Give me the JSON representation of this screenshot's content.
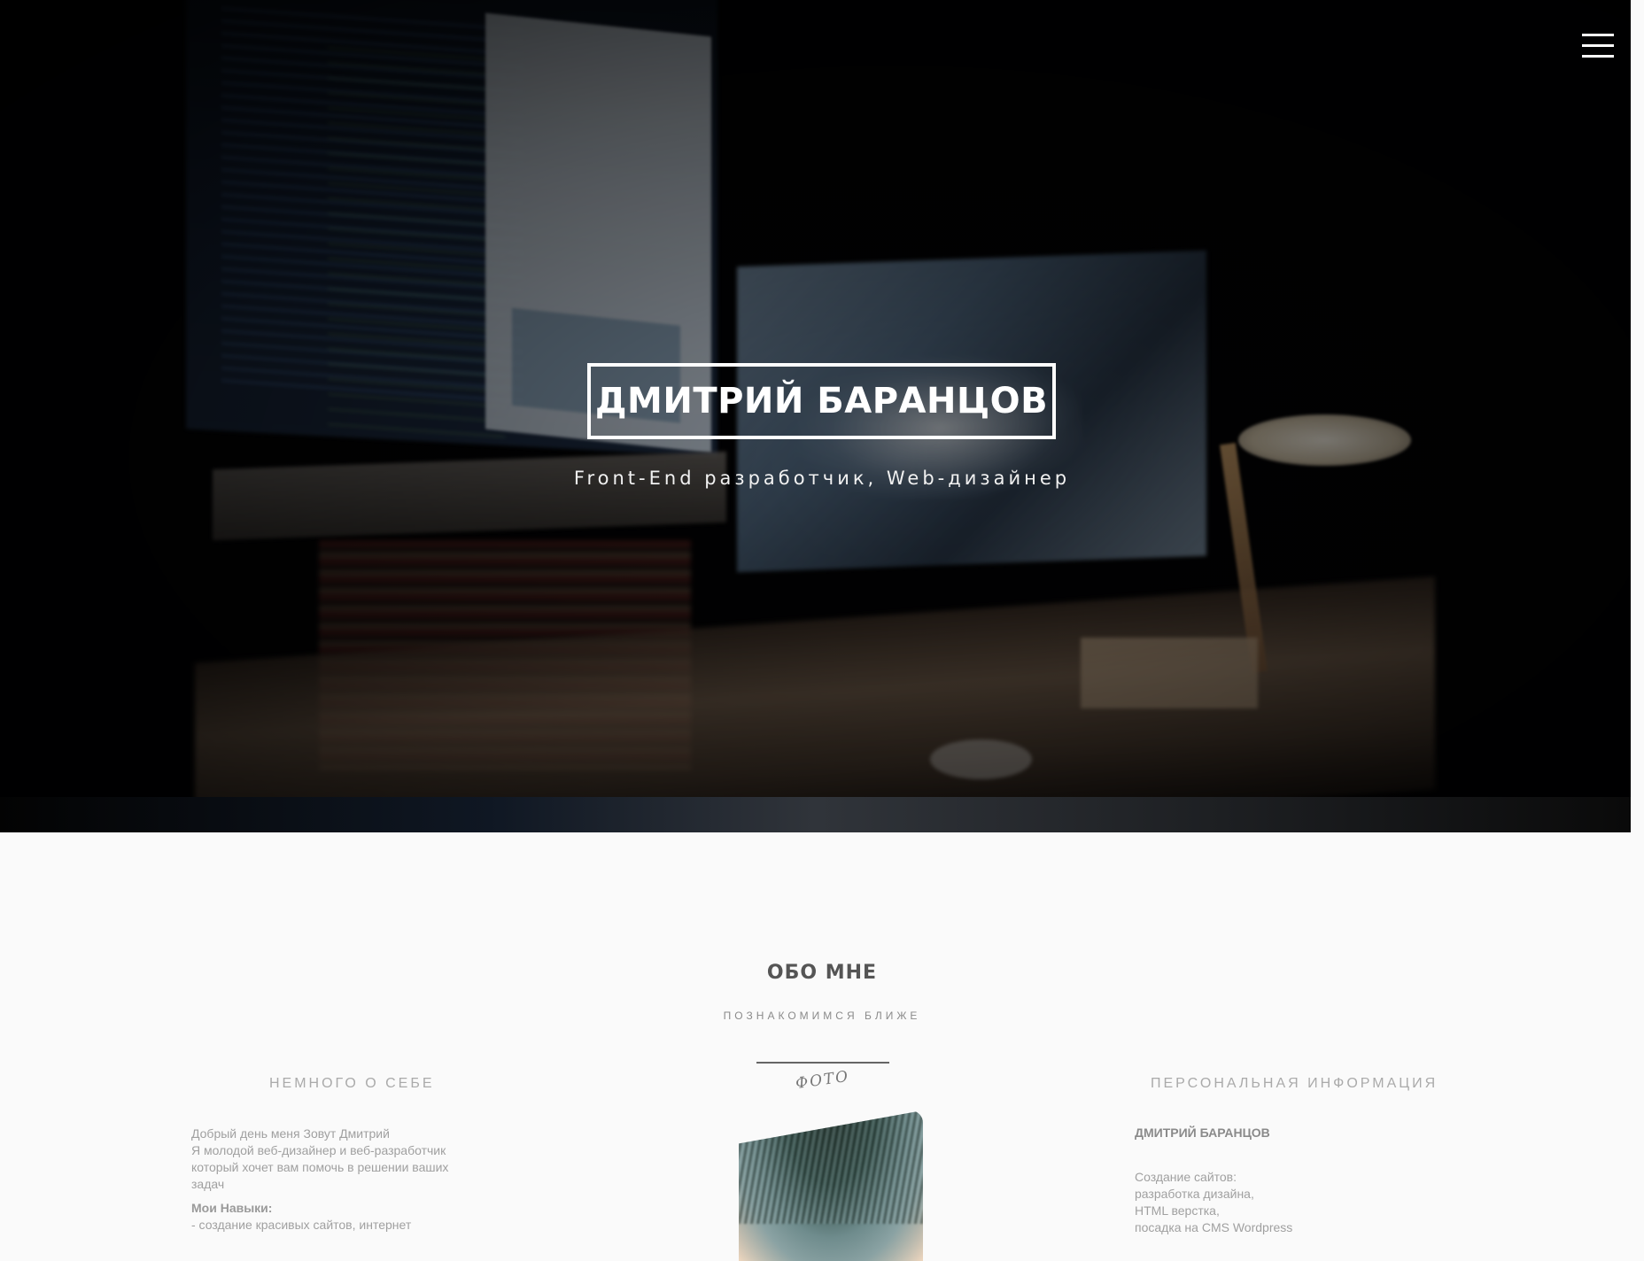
{
  "hero": {
    "title": "ДМИТРИЙ БАРАНЦОВ",
    "subtitle": "Front-End разработчик, Web-дизайнер",
    "menu_icon": "hamburger-menu-icon"
  },
  "about": {
    "title": "ОБО МНЕ",
    "subtitle": "ПОЗНАКОМИМСЯ БЛИЖЕ",
    "photo_caption": "ФОТО",
    "left": {
      "heading": "НЕМНОГО О СЕБЕ",
      "lines": [
        "Добрый день меня Зовут Дмитрий",
        "Я молодой веб-дизайнер и веб-разработчик",
        "который хочет вам помочь в решении ваших",
        "задач"
      ],
      "skills_label": "Мои Навыки:",
      "skills_first": "- создание красивых сайтов, интернет"
    },
    "right": {
      "heading": "ПЕРСОНАЛЬНАЯ ИНФОРМАЦИЯ",
      "name": "ДМИТРИЙ БАРАНЦОВ",
      "services": [
        "Создание сайтов:",
        "разработка дизайна,",
        "HTML верстка,",
        "посадка на CMS Wordpress"
      ]
    }
  }
}
